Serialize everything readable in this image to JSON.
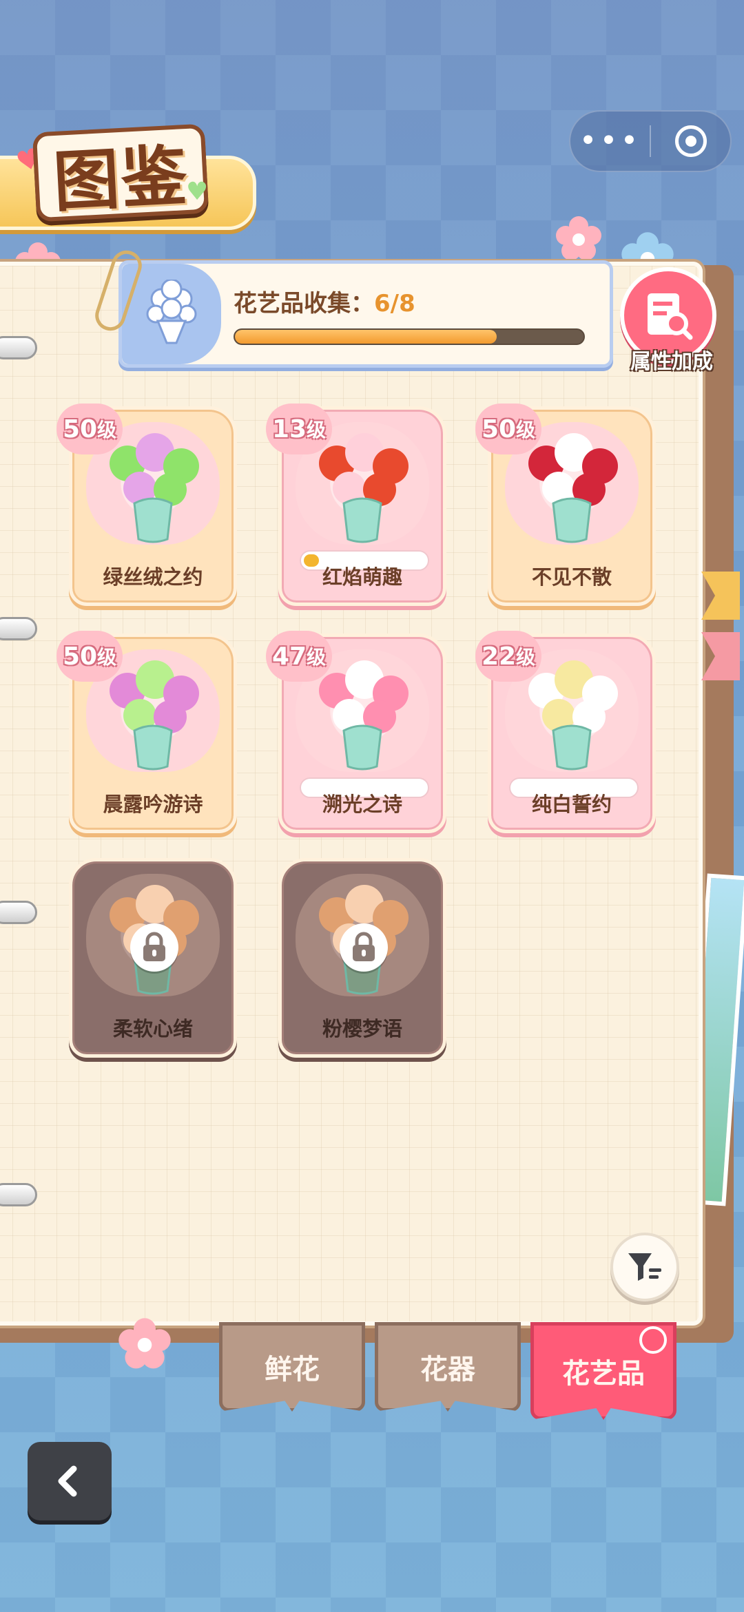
{
  "header": {
    "title": "图鉴"
  },
  "capsule": {
    "more_icon": "more-dots-icon",
    "close_icon": "target-icon"
  },
  "collection": {
    "label": "花艺品收集：",
    "count": "6/8",
    "progress": 0.75
  },
  "bonus": {
    "label": "属性加成"
  },
  "cards": [
    {
      "name": "绿丝绒之约",
      "level": "50",
      "level_unit": "级",
      "locked": false,
      "style": "orange"
    },
    {
      "name": "红焰萌趣",
      "level": "13",
      "level_unit": "级",
      "locked": false,
      "style": "pink",
      "progress": 0.08
    },
    {
      "name": "不见不散",
      "level": "50",
      "level_unit": "级",
      "locked": false,
      "style": "orange"
    },
    {
      "name": "晨露吟游诗",
      "level": "50",
      "level_unit": "级",
      "locked": false,
      "style": "orange"
    },
    {
      "name": "溯光之诗",
      "level": "47",
      "level_unit": "级",
      "locked": false,
      "style": "pink",
      "progress": 0.0
    },
    {
      "name": "纯白誓约",
      "level": "22",
      "level_unit": "级",
      "locked": false,
      "style": "pink",
      "progress": 0.0
    },
    {
      "name": "柔软心绪",
      "locked": true,
      "style": "locked"
    },
    {
      "name": "粉樱梦语",
      "locked": true,
      "style": "locked"
    }
  ],
  "tabs": [
    {
      "label": "鲜花",
      "active": false
    },
    {
      "label": "花器",
      "active": false
    },
    {
      "label": "花艺品",
      "active": true
    }
  ],
  "colors": {
    "accent_pink": "#ff5b78",
    "progress_orange": "#f39b2f",
    "text_brown": "#6b3f28"
  }
}
